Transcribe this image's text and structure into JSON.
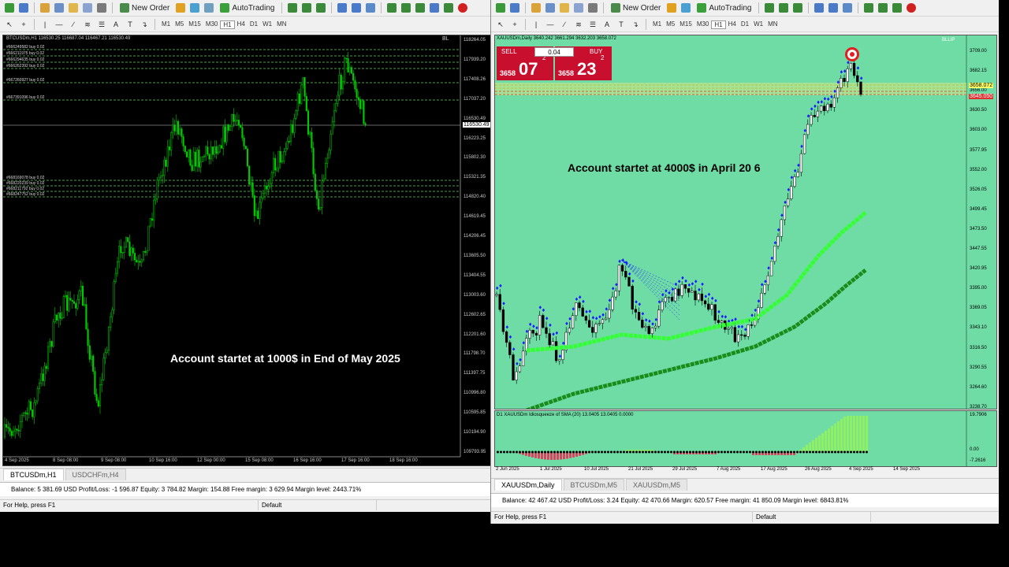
{
  "left_window": {
    "toolbar": {
      "new_order_label": "New Order",
      "autotrading_label": "AutoTrading",
      "timeframes": [
        "M1",
        "M5",
        "M15",
        "M30",
        "H1",
        "H4",
        "D1",
        "W1",
        "MN"
      ]
    },
    "chart": {
      "header": "BTCUSDm,H1  116530.25 116687.04 116467.21 116530.49",
      "badge": "BL",
      "order_labels": [
        "#666249582 buy 0.02",
        "#666211975 buy 0.02",
        "#666294635 buy 0.02",
        "#666262392 buy 0.02",
        "#667260927 buy 0.02",
        "#667391096 buy 0.02",
        "#668169078 buy 0.02",
        "#668220239 buy 0.02",
        "#668211792 buy 0.02",
        "#668247752 buy 0.02"
      ],
      "price_ticks": [
        "118264.05",
        "117939.20",
        "117408.26",
        "117037.20",
        "116530.49",
        "116223.25",
        "115802.30",
        "115321.35",
        "114820.40",
        "114619.45",
        "114206.45",
        "113605.50",
        "113404.55",
        "113003.60",
        "112602.65",
        "112201.60",
        "111798.70",
        "111397.75",
        "110996.80",
        "110595.85",
        "110194.90",
        "109793.95"
      ],
      "current_price_tag": "116530.49",
      "time_ticks": [
        "4 Sep 2025",
        "8 Sep 08:00",
        "9 Sep 08:00",
        "10 Sep 16:00",
        "12 Sep 00:00",
        "15 Sep 08:00",
        "16 Sep 16:00",
        "17 Sep 16:00",
        "18 Sep 16:00"
      ],
      "overlay_text": "Account startet at 1000$ in End of May 2025"
    },
    "tabs": [
      "BTCUSDm,H1",
      "USDCHFm,H4"
    ],
    "terminal_line": "Balance: 5 381.69 USD  Profit/Loss: -1 596.87  Equity: 3 784.82  Margin: 154.88  Free margin: 3 629.94  Margin level: 2443.71%",
    "status": {
      "help": "For Help, press F1",
      "profile": "Default"
    }
  },
  "right_window": {
    "toolbar": {
      "new_order_label": "New Order",
      "autotrading_label": "AutoTrading",
      "timeframes": [
        "M1",
        "M5",
        "M15",
        "M30",
        "H1",
        "H4",
        "D1",
        "W1",
        "MN"
      ]
    },
    "chart": {
      "header": "XAUUSDm,Daily  3640.242 3661.294 3632.203 3658.072",
      "badge": "BLLIP",
      "trade_panel": {
        "sell_label": "SELL",
        "buy_label": "BUY",
        "lot": "0.04",
        "sell_small": "3658",
        "sell_big": "07",
        "sell_sup": "2",
        "buy_small": "3658",
        "buy_big": "23",
        "buy_sup": "2"
      },
      "price_ticks": [
        "3709.00",
        "3682.15",
        "3656.00",
        "3630.50",
        "3603.00",
        "3577.95",
        "3552.00",
        "3526.05",
        "3499.45",
        "3473.50",
        "3447.55",
        "3420.95",
        "3395.00",
        "3369.05",
        "3343.10",
        "3316.50",
        "3290.55",
        "3264.60",
        "3238.70"
      ],
      "price_tag_top": "3658.072",
      "price_tag_red": "3645.050",
      "time_ticks": [
        "2 Jun 2025",
        "1 Jul 2025",
        "10 Jul 2025",
        "21 Jul 2025",
        "29 Jul 2025",
        "7 Aug 2025",
        "17 Aug 2025",
        "26 Aug 2025",
        "4 Sep 2025",
        "14 Sep 2025"
      ],
      "overlay_text": "Account startet at 4000$ in April 20 6",
      "indicator_header": "D1 XAUUSDm Idiosqueeze of SMA (20) 13.0405 13.0405 0.0000",
      "indicator_ticks": [
        "19.7906",
        "0.00",
        "-7.2616"
      ]
    },
    "tabs": [
      "XAUUSDm,Daily",
      "BTCUSDm,M5",
      "XAUUSDm,M5"
    ],
    "terminal_line": "Balance: 42 467.42 USD  Profit/Loss: 3.24  Equity: 42 470.66  Margin: 620.57  Free margin: 41 850.09  Margin level: 6843.81%",
    "status": {
      "help": "For Help, press F1",
      "profile": "Default"
    }
  },
  "colors": {
    "left_candles": "#00cc00",
    "right_bg": "#6fdca6",
    "right_candles": "#1a1aff",
    "ma_fast": "#33ff33",
    "ma_slow": "#1a8c1a",
    "sell_buy": "#c8102e"
  }
}
